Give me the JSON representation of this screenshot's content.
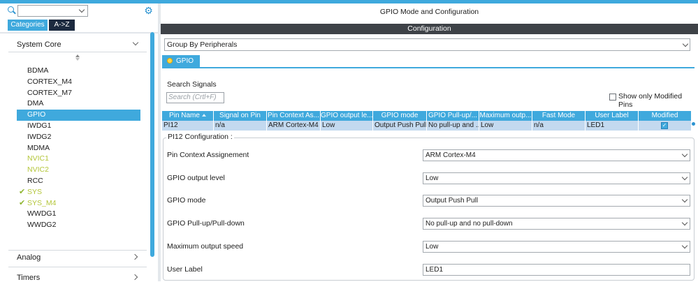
{
  "left": {
    "tabs": {
      "categories": "Categories",
      "az": "A->Z"
    },
    "sections": {
      "system_core": "System Core",
      "analog": "Analog",
      "timers": "Timers"
    },
    "peripherals": [
      {
        "name": "BDMA",
        "state": "normal"
      },
      {
        "name": "CORTEX_M4",
        "state": "normal"
      },
      {
        "name": "CORTEX_M7",
        "state": "normal"
      },
      {
        "name": "DMA",
        "state": "normal"
      },
      {
        "name": "GPIO",
        "state": "selected"
      },
      {
        "name": "IWDG1",
        "state": "normal"
      },
      {
        "name": "IWDG2",
        "state": "normal"
      },
      {
        "name": "MDMA",
        "state": "normal"
      },
      {
        "name": "NVIC1",
        "state": "warning"
      },
      {
        "name": "NVIC2",
        "state": "warning"
      },
      {
        "name": "RCC",
        "state": "normal"
      },
      {
        "name": "SYS",
        "state": "checked"
      },
      {
        "name": "SYS_M4",
        "state": "checked"
      },
      {
        "name": "WWDG1",
        "state": "normal"
      },
      {
        "name": "WWDG2",
        "state": "normal"
      }
    ]
  },
  "right": {
    "title": "GPIO Mode and Configuration",
    "configuration_bar": "Configuration",
    "group_by": "Group By Peripherals",
    "tab": "GPIO",
    "search_label": "Search Signals",
    "search_placeholder": "Search (Crtl+F)",
    "show_modified": "Show only Modified Pins",
    "table": {
      "columns": [
        "Pin Name",
        "Signal on Pin",
        "Pin Context As...",
        "GPIO output le...",
        "GPIO mode",
        "GPIO Pull-up/...",
        "Maximum outp...",
        "Fast Mode",
        "User Label",
        "Modified"
      ],
      "rows": [
        [
          "PI12",
          "n/a",
          "ARM Cortex-M4",
          "Low",
          "Output Push Pull",
          "No pull-up and ...",
          "Low",
          "n/a",
          "LED1",
          ""
        ]
      ],
      "modified": [
        true
      ]
    },
    "config": {
      "legend": "PI12 Configuration :",
      "fields": [
        {
          "label": "Pin Context Assignement",
          "value": "ARM Cortex-M4",
          "kind": "combo"
        },
        {
          "label": "GPIO output level",
          "value": "Low",
          "kind": "combo"
        },
        {
          "label": "GPIO mode",
          "value": "Output Push Pull",
          "kind": "combo"
        },
        {
          "label": "GPIO Pull-up/Pull-down",
          "value": "No pull-up and no pull-down",
          "kind": "combo"
        },
        {
          "label": "Maximum output speed",
          "value": "Low",
          "kind": "combo"
        },
        {
          "label": "User Label",
          "value": "LED1",
          "kind": "text"
        }
      ]
    }
  },
  "colors": {
    "accent": "#3fa9dd",
    "dark_bar": "#3e4247",
    "warning_text": "#b4c63a",
    "check": "#8fb531"
  }
}
